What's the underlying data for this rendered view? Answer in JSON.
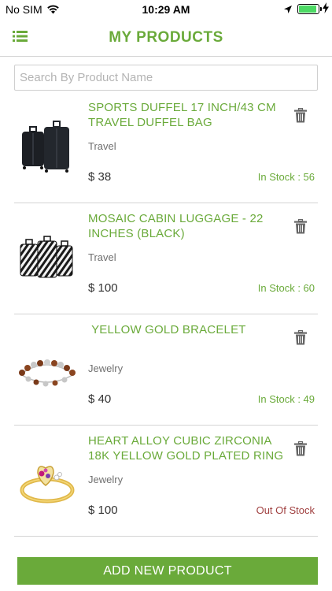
{
  "status_bar": {
    "carrier": "No SIM",
    "time": "10:29 AM",
    "battery_level": 0.9
  },
  "header": {
    "title": "MY PRODUCTS"
  },
  "search": {
    "placeholder": "Search By Product Name",
    "value": ""
  },
  "products": [
    {
      "name": "SPORTS DUFFEL 17 INCH/43 CM TRAVEL DUFFEL BAG",
      "category": "Travel",
      "price": "$ 38",
      "stock": "In Stock : 56"
    },
    {
      "name": "MOSAIC CABIN LUGGAGE - 22 INCHES  (BLACK)",
      "category": "Travel",
      "price": "$ 100",
      "stock": "In Stock : 60"
    },
    {
      "name": " YELLOW GOLD BRACELET",
      "category": "Jewelry",
      "price": "$ 40",
      "stock": "In Stock : 49"
    },
    {
      "name": "HEART ALLOY CUBIC ZIRCONIA 18K YELLOW GOLD PLATED RING",
      "category": "Jewelry",
      "price": "$ 100",
      "stock": "Out Of Stock"
    }
  ],
  "footer": {
    "add_label": "ADD NEW PRODUCT"
  },
  "colors": {
    "accent": "#6aaa3a",
    "out_of_stock": "#a04040",
    "battery": "#4cd964"
  },
  "icons": [
    "wifi-icon",
    "location-arrow-icon",
    "battery-icon",
    "charging-bolt-icon",
    "list-menu-icon",
    "trash-icon"
  ]
}
